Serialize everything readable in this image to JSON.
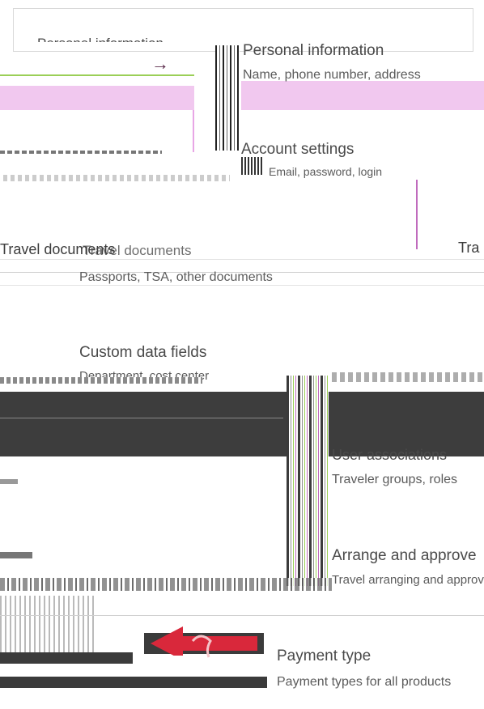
{
  "sections": {
    "personal": {
      "title": "Personal information",
      "subtitle": "Name, phone number, address"
    },
    "account": {
      "title": "Account settings",
      "subtitle": "Email, password, login"
    },
    "travel_docs": {
      "title": "Travel documents",
      "subtitle": "Passports, TSA, other documents"
    },
    "custom_fields": {
      "title": "Custom data fields",
      "subtitle": "Department, cost center"
    },
    "user_assoc": {
      "title": "User associations",
      "subtitle": "Traveler groups, roles"
    },
    "arrange": {
      "title": "Arrange and approve",
      "subtitle": "Travel arranging and approval"
    },
    "payment": {
      "title": "Payment type",
      "subtitle": "Payment types for all products"
    }
  },
  "fragments": {
    "personal_left": "Personal information",
    "travel_left": "Travel documents",
    "travel_right": "Tra"
  },
  "arrow_glyph": "→",
  "colors": {
    "pink": "#f1c8ef",
    "green": "#9bcf57",
    "dark": "#3d3d3d",
    "red": "#d9283b"
  }
}
